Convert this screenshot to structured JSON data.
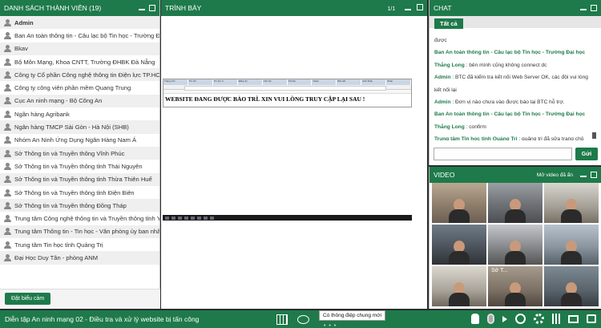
{
  "members": {
    "title": "DANH SÁCH THÀNH VIÊN (19)",
    "items": [
      "Admin",
      "Ban An toàn thông tin - Câu lạc bộ Tin học - Trường Đại học",
      "Bkav",
      "Bộ Môn Mạng, Khoa CNTT, Trường ĐHBK Đà Nẵng",
      "Công ty Cổ phần Công nghệ thông tin Điện lực TP.HCM",
      "Công ty công viên phần mềm Quang Trung",
      "Cục An ninh mạng - Bộ Công An",
      "Ngân hàng Agribank",
      "Ngân hàng TMCP Sài Gòn - Hà Nội (SHB)",
      "Nhóm An Ninh Ứng Dụng Ngân Hàng Nam Á",
      "Sở Thông tin và Truyền thông Vĩnh Phúc",
      "Sở Thông tin và Truyền thông tỉnh Thái Nguyên",
      "Sở Thông tin và Truyền thông tỉnh Thừa Thiên Huế",
      "Sở Thông tin và Truyền thông tỉnh Điện Biên",
      "Sở Thông tin và Truyền thông Đồng Tháp",
      "Trung tâm Công nghệ thông tin và Truyền thông tỉnh Yên Bái",
      "Trung tâm Thông tin - Tin học - Văn phòng ủy ban nhân dân",
      "Trung tâm Tin học tỉnh Quảng Trị",
      "Đại Học Duy Tân - phòng ANM"
    ],
    "raise_hand_label": "Đặt biểu cảm"
  },
  "presentation": {
    "title": "TRÌNH BÀY",
    "page": "1/1",
    "browser_tabs": [
      "Trang chủ",
      "Tin tức",
      "Tin tức 2",
      "Đăng ký",
      "Liên hệ",
      "Tài liệu",
      "Video",
      "Bài viết",
      "Giới thiệu",
      "Khác"
    ],
    "notice": "WEBSITE ĐANG ĐƯỢC BẢO TRÌ. XIN VUI LÒNG TRUY CẬP LẠI SAU !"
  },
  "chat": {
    "title": "CHAT",
    "tab": "Tất cả",
    "messages": [
      {
        "who": "",
        "text": "được"
      },
      {
        "who": "Ban An toàn thông tin - Câu lạc bộ Tin học - Trường Đại học",
        "text": ""
      },
      {
        "who": "Thắng Long",
        "text": " : bên mình cũng không connect dc"
      },
      {
        "who": "Admin",
        "text": " : BTC đã kiểm tra kết nối Web Server OK, các đội vui lòng kết nối lại"
      },
      {
        "who": "Admin",
        "text": " : Đơn vị nào chưa vào được báo lại BTC hỗ trợ."
      },
      {
        "who": "Ban An toàn thông tin - Câu lạc bộ Tin học - Trường Đại học",
        "text": ""
      },
      {
        "who": "Thắng Long",
        "text": " : confirm"
      },
      {
        "who": "Trung tâm Tin học tỉnh Quảng Trị",
        "text": " : quảng trị đã sửa trang chủ"
      }
    ],
    "send_label": "Gửi"
  },
  "video": {
    "title": "VIDEO",
    "open_label": "Mở video đã ẩn",
    "tile_label": "Sở T..."
  },
  "bottom": {
    "meeting_title": "Diễn tập An ninh mạng 02 - Điều tra và xử lý website bị tấn công",
    "notice": "Có thông điệp chung mới",
    "dots": "• • •"
  }
}
